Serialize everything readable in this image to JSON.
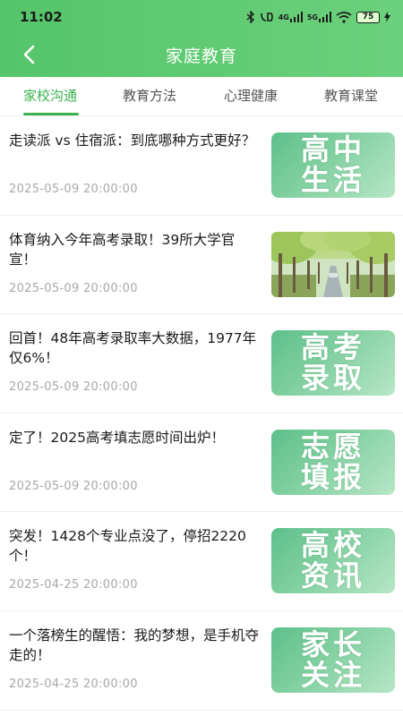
{
  "status": {
    "time": "11:02",
    "network_4g": "4G",
    "network_5g": "5G",
    "battery": "75"
  },
  "nav": {
    "title": "家庭教育"
  },
  "tabs": [
    {
      "label": "家校沟通",
      "active": true
    },
    {
      "label": "教育方法",
      "active": false
    },
    {
      "label": "心理健康",
      "active": false
    },
    {
      "label": "教育课堂",
      "active": false
    }
  ],
  "articles": [
    {
      "title": "走读派 vs 住宿派：到底哪种方式更好？",
      "date": "2025-05-09 20:00:00",
      "thumb": {
        "line1": "高中",
        "line2": "生活"
      }
    },
    {
      "title": "体育纳入今年高考录取！39所大学官宣！",
      "date": "2025-05-09 20:00:00",
      "thumb_icon": "tree-lined-road-photo"
    },
    {
      "title": "回首！48年高考录取率大数据，1977年仅6%！",
      "date": "2025-05-09 20:00:00",
      "thumb": {
        "line1": "高考",
        "line2": "录取"
      }
    },
    {
      "title": "定了！2025高考填志愿时间出炉！",
      "date": "2025-05-09 20:00:00",
      "thumb": {
        "line1": "志愿",
        "line2": "填报"
      }
    },
    {
      "title": "突发！1428个专业点没了，停招2220个！",
      "date": "2025-04-25 20:00:00",
      "thumb": {
        "line1": "高校",
        "line2": "资讯"
      }
    },
    {
      "title": "一个落榜生的醒悟：我的梦想，是手机夺走的！",
      "date": "2025-04-25 20:00:00",
      "thumb": {
        "line1": "家长",
        "line2": "关注"
      }
    }
  ],
  "colors": {
    "header": "#5cc86e",
    "accent": "#3bb24e",
    "date": "#a8a8a8"
  }
}
